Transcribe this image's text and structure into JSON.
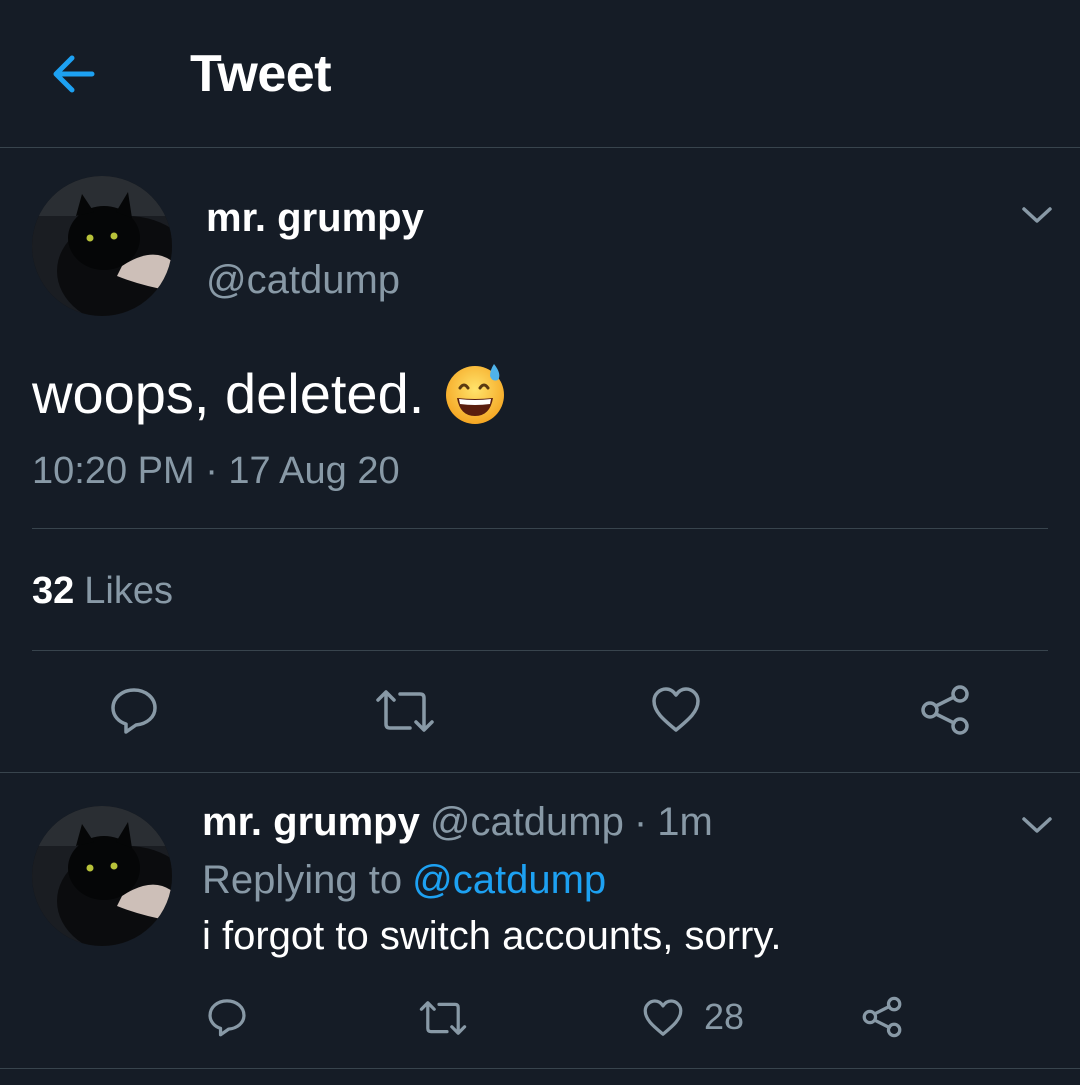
{
  "header": {
    "title": "Tweet",
    "back_icon": "arrow-left-icon"
  },
  "colors": {
    "background": "#151c26",
    "accent": "#1da1f2",
    "secondary_text": "#8899a6",
    "divider": "#38444d"
  },
  "main_tweet": {
    "display_name": "mr. grumpy",
    "handle": "@catdump",
    "text": "woops, deleted.",
    "emoji": "grinning-face-with-sweat",
    "timestamp": "10:20 PM · 17 Aug 20",
    "likes_count": "32",
    "likes_label": "Likes",
    "actions": [
      "reply-icon",
      "retweet-icon",
      "like-icon",
      "share-icon"
    ]
  },
  "reply_tweet": {
    "display_name": "mr. grumpy",
    "handle": "@catdump",
    "separator": "·",
    "time": "1m",
    "replying_prefix": "Replying to",
    "replying_mention": "@catdump",
    "text": "i forgot to switch accounts, sorry.",
    "like_count": "28",
    "actions": [
      "reply-icon",
      "retweet-icon",
      "like-icon",
      "share-icon"
    ]
  }
}
